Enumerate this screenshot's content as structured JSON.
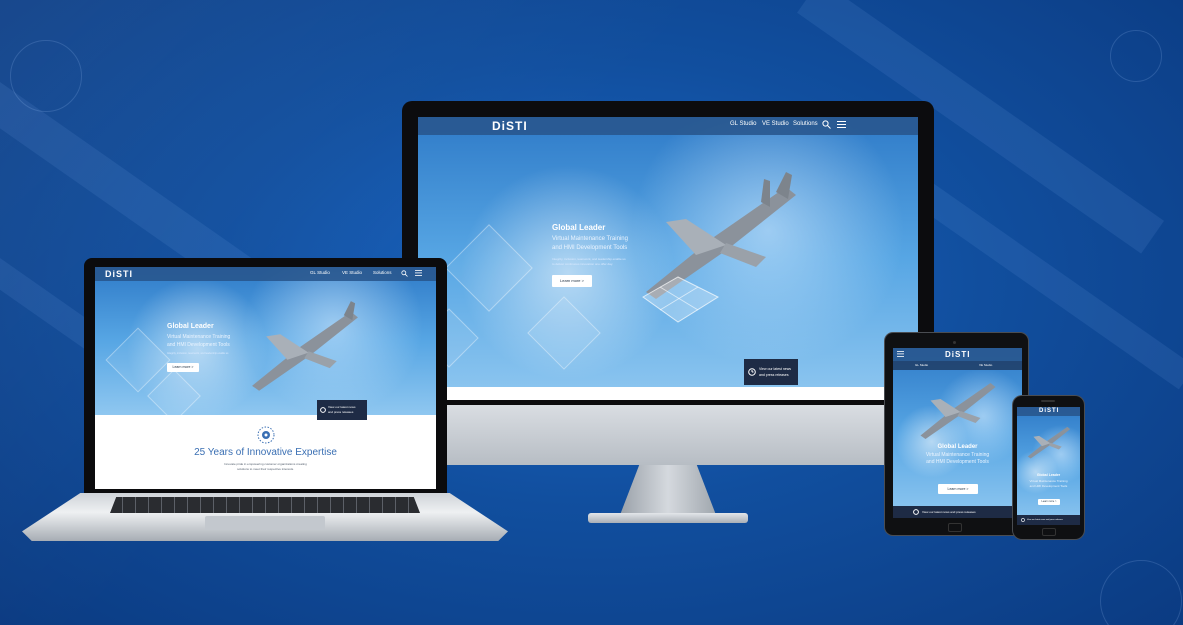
{
  "brand": {
    "logo": "DiSTI"
  },
  "nav": {
    "items": [
      "GL Studio",
      "VE Studio",
      "Solutions"
    ],
    "search_icon": "search-icon",
    "menu_icon": "hamburger-menu-icon"
  },
  "hero": {
    "title": "Global Leader",
    "subtitle_line1": "Virtual Maintenance Training",
    "subtitle_line2": "and HMI Development Tools",
    "body_line1": "Integrity, inclusion, teamwork, and leadership enable us",
    "body_line2": "to deliver continuous innovation one offer day.",
    "cta_label": "Learn more >"
  },
  "news_banner": {
    "line1": "View our latest news",
    "line2": "and press releases",
    "single_line": "View our latest news and press releases"
  },
  "about": {
    "heading": "25 Years of Innovative Expertise",
    "body_line1": "Innovate pride in empowering customer organizations creating",
    "body_line2": "solutions to meet their respective interests."
  },
  "colors": {
    "background": "#0d4a9c",
    "nav_bar": "#28558c",
    "news_banner": "#1e2b45",
    "accent_text": "#3a6fb3"
  }
}
